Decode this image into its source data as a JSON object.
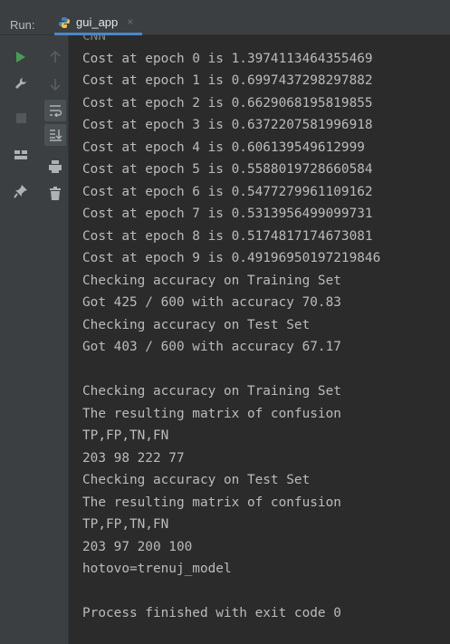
{
  "header": {
    "run_label": "Run:",
    "tab_label": "gui_app",
    "tab_close": "×",
    "cutoff_top_text": "CNN"
  },
  "toolbar": {
    "left_icons": [
      "run-icon",
      "stop-rerun-icon",
      "wrench-icon",
      "pin-icon",
      "layout-icon"
    ],
    "right_icons": [
      "up-arrow-icon",
      "down-arrow-icon",
      "soft-wrap-icon",
      "scroll-to-end-icon",
      "print-icon",
      "trash-icon"
    ]
  },
  "console": {
    "lines": [
      "CNN",
      "Cost at epoch 0 is 1.3974113464355469",
      "Cost at epoch 1 is 0.6997437298297882",
      "Cost at epoch 2 is 0.6629068195819855",
      "Cost at epoch 3 is 0.6372207581996918",
      "Cost at epoch 4 is 0.606139549612999",
      "Cost at epoch 5 is 0.5588019728660584",
      "Cost at epoch 6 is 0.5477279961109162",
      "Cost at epoch 7 is 0.5313956499099731",
      "Cost at epoch 8 is 0.5174817174673081",
      "Cost at epoch 9 is 0.49196950197219846",
      "Checking accuracy on Training Set",
      "Got 425 / 600 with accuracy 70.83",
      "Checking accuracy on Test Set",
      "Got 403 / 600 with accuracy 67.17",
      "",
      "Checking accuracy on Training Set",
      "The resulting matrix of confusion",
      "TP,FP,TN,FN",
      "203 98 222 77",
      "Checking accuracy on Test Set",
      "The resulting matrix of confusion",
      "TP,FP,TN,FN",
      "203 97 200 100",
      "hotovo=trenuj_model",
      "",
      "Process finished with exit code 0"
    ]
  },
  "colors": {
    "background": "#2b2b2b",
    "panel": "#3c3f41",
    "text": "#bbbbbb",
    "run_green": "#499c54",
    "tab_underline": "#4a88c7"
  }
}
